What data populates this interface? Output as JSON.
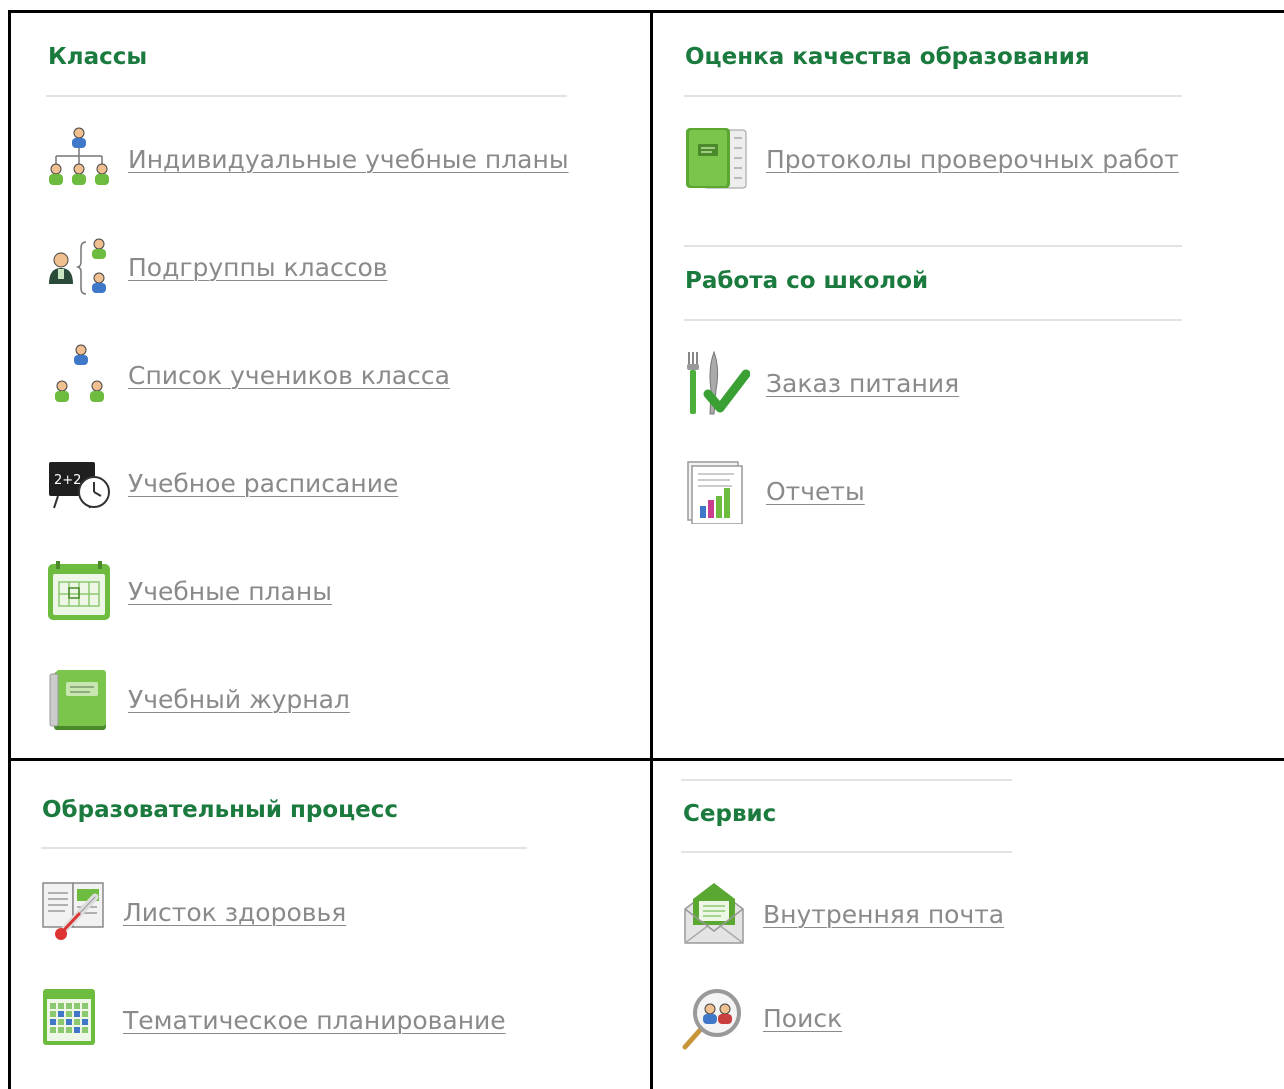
{
  "sections": {
    "classes": {
      "title": "Классы",
      "items": [
        {
          "label": "Индивидуальные учебные планы",
          "icon": "org-chart-icon"
        },
        {
          "label": "Подгруппы классов",
          "icon": "subgroups-icon"
        },
        {
          "label": "Список учеников класса",
          "icon": "students-list-icon"
        },
        {
          "label": "Учебное расписание",
          "icon": "schedule-board-icon"
        },
        {
          "label": "Учебные планы",
          "icon": "calendar-icon"
        },
        {
          "label": "Учебный журнал",
          "icon": "journal-icon"
        }
      ]
    },
    "quality": {
      "title": "Оценка качества образования",
      "items": [
        {
          "label": "Протоколы проверочных работ",
          "icon": "green-book-icon"
        }
      ]
    },
    "school": {
      "title": "Работа со школой",
      "items": [
        {
          "label": "Заказ питания",
          "icon": "cutlery-check-icon"
        },
        {
          "label": "Отчеты",
          "icon": "report-chart-icon"
        }
      ]
    },
    "process": {
      "title": "Образовательный процесс",
      "items": [
        {
          "label": "Листок здоровья",
          "icon": "thermometer-book-icon"
        },
        {
          "label": "Тематическое планирование",
          "icon": "grid-calendar-icon"
        }
      ]
    },
    "service": {
      "title": "Сервис",
      "items": [
        {
          "label": "Внутренняя почта",
          "icon": "envelope-icon"
        },
        {
          "label": "Поиск",
          "icon": "search-people-icon"
        }
      ]
    }
  },
  "colors": {
    "title_green": "#1b7a3e",
    "link_gray": "#8a8a8a",
    "icon_green": "#6dbb3f",
    "grid_line": "#000000"
  }
}
